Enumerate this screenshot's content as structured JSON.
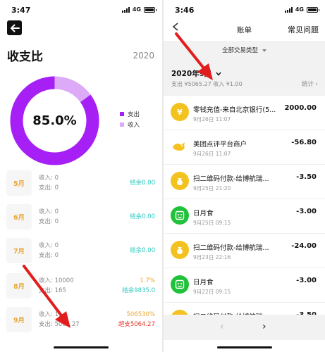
{
  "left": {
    "status": {
      "time": "3:47",
      "network": "4G"
    },
    "title": "收支比",
    "year": "2020",
    "ratio": {
      "label": "85.0%",
      "expense_fraction": 0.85,
      "colors": {
        "expense": "#a620f5",
        "income": "#dcaaf7"
      }
    },
    "legend": [
      {
        "label": "支出",
        "color": "#a620f5"
      },
      {
        "label": "收入",
        "color": "#dcaaf7"
      }
    ],
    "months": [
      {
        "month": "5月",
        "income": "收入: 0",
        "expense": "支出: 0",
        "pct": "",
        "result": "结余0.00",
        "pct_class": "",
        "result_class": "c-teal"
      },
      {
        "month": "6月",
        "income": "收入: 0",
        "expense": "支出: 0",
        "pct": "",
        "result": "结余0.00",
        "pct_class": "",
        "result_class": "c-teal"
      },
      {
        "month": "7月",
        "income": "收入: 0",
        "expense": "支出: 0",
        "pct": "",
        "result": "结余0.00",
        "pct_class": "",
        "result_class": "c-teal"
      },
      {
        "month": "8月",
        "income": "收入: 10000",
        "expense": "支出: 165",
        "pct": "1.7%",
        "result": "结余9835.0",
        "pct_class": "c-orange",
        "result_class": "c-teal"
      },
      {
        "month": "9月",
        "income": "收入: 1",
        "expense": "支出: 5065.27",
        "pct": "506530%",
        "result": "超支5064.27",
        "pct_class": "c-orange",
        "result_class": "c-red"
      }
    ]
  },
  "right": {
    "status": {
      "time": "3:46",
      "network": "4G"
    },
    "nav": {
      "title": "账单",
      "faq": "常见问题"
    },
    "type_filter": "全部交易类型",
    "month_select": "2020年9月",
    "summary": "支出 ¥5065.27 收入 ¥1.00",
    "stats": "统计",
    "transactions": [
      {
        "name": "零钱充值-来自北京银行(5...",
        "date": "9月26日 11:07",
        "amount": "2000.00",
        "icon": "yen-coin-icon",
        "icon_color": "#f4c21f"
      },
      {
        "name": "美团点评平台商户",
        "date": "9月26日 11:07",
        "amount": "-56.80",
        "icon": "meituan-bird-icon",
        "icon_color": "#f7c21f"
      },
      {
        "name": "扫二维码付款-给博航瑞...",
        "date": "9月25日 21:20",
        "amount": "-3.50",
        "icon": "money-bag-icon",
        "icon_color": "#f4c21f"
      },
      {
        "name": "日月食",
        "date": "9月25日 09:15",
        "amount": "-3.00",
        "icon": "wechat-pay-icon",
        "icon_color": "#1fc23a"
      },
      {
        "name": "扫二维码付款-给博航瑞...",
        "date": "9月23日 22:16",
        "amount": "-24.00",
        "icon": "money-bag-icon",
        "icon_color": "#f4c21f"
      },
      {
        "name": "日月食",
        "date": "9月22日 09:15",
        "amount": "-3.00",
        "icon": "wechat-pay-icon",
        "icon_color": "#1fc23a"
      },
      {
        "name": "扫二维码付款-给博航瑞...",
        "date": "",
        "amount": "-3.50",
        "icon": "money-bag-icon",
        "icon_color": "#f4c21f"
      }
    ],
    "pager": {
      "prev": "‹",
      "next": "›"
    }
  },
  "annotation_color": "#e11d1d"
}
